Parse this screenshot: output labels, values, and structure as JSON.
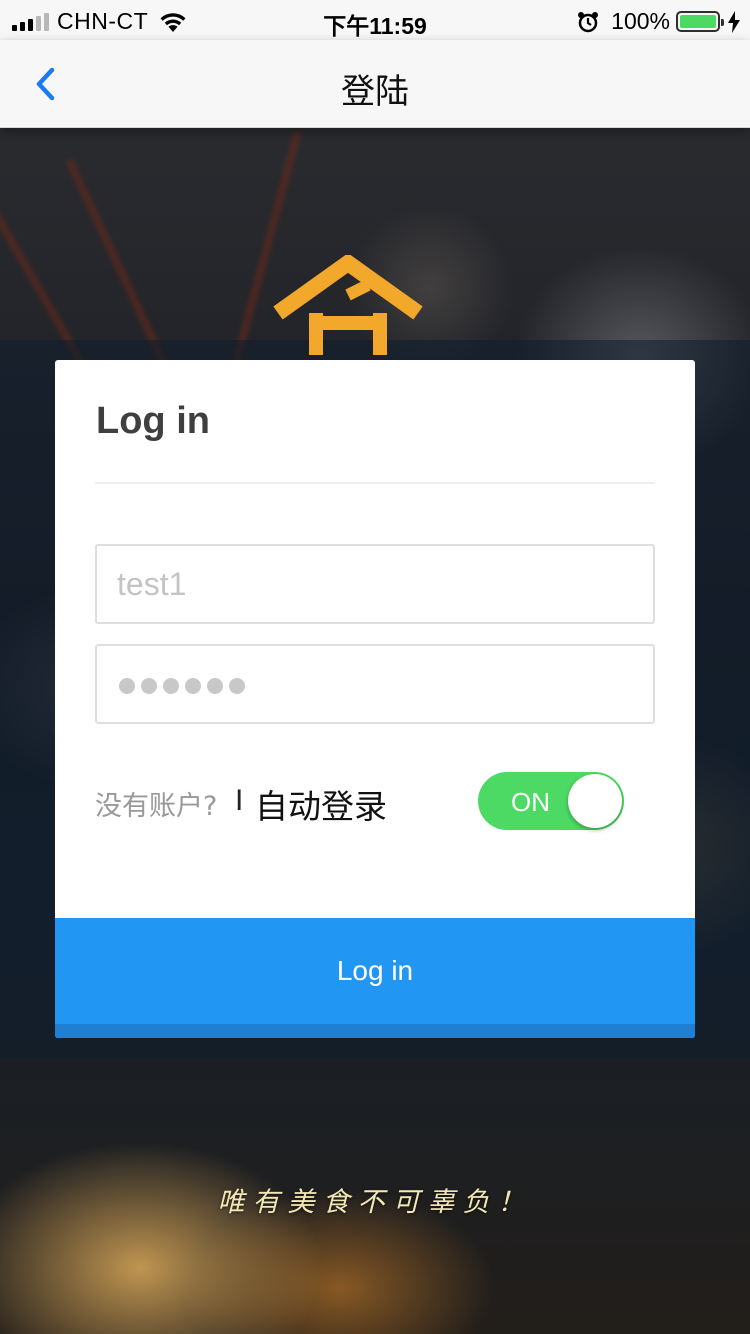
{
  "status_bar": {
    "carrier": "CHN-CT",
    "time": "下午11:59",
    "battery_percent": "100%"
  },
  "nav": {
    "title": "登陆",
    "back_icon": "chevron-left-icon"
  },
  "login": {
    "title": "Log in",
    "username_placeholder": "test1",
    "password_mask_length": 6,
    "register_link": "没有账户?",
    "separator": "I",
    "auto_login_label": "自动登录",
    "auto_login_toggle": "ON",
    "auto_login_enabled": true,
    "submit_label": "Log in"
  },
  "slogan": "唯有美食不可辜负！",
  "colors": {
    "accent": "#2196f3",
    "toggle_on": "#4cd964",
    "logo": "#f2a82a",
    "ios_blue": "#1a7cf5"
  }
}
